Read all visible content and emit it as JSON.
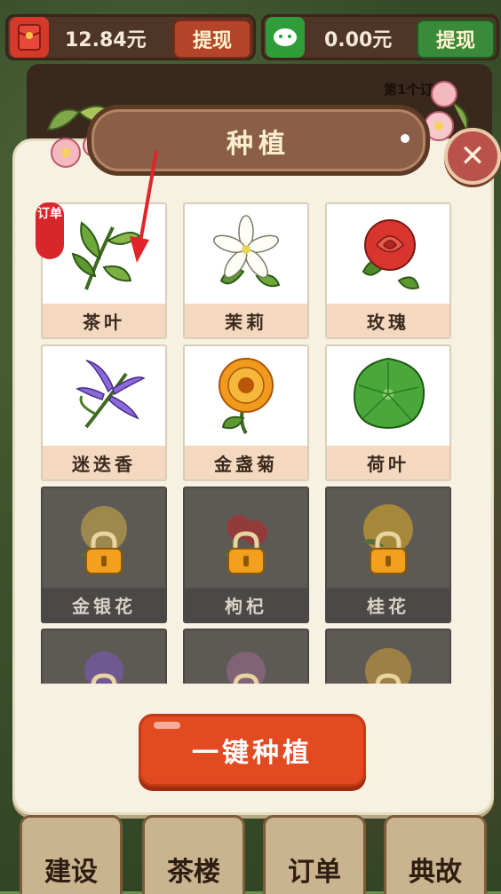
{
  "top_bar": {
    "cash_value": "12.84元",
    "cash_withdraw_label": "提现",
    "wechat_value": "0.00元",
    "wechat_withdraw_label": "提现"
  },
  "background": {
    "order_card_text": "第1个订"
  },
  "panel": {
    "title": "种植",
    "close_label": "✕",
    "order_badge": "订单",
    "plants": [
      {
        "name": "茶叶",
        "locked": false
      },
      {
        "name": "茉莉",
        "locked": false
      },
      {
        "name": "玫瑰",
        "locked": false
      },
      {
        "name": "迷迭香",
        "locked": false
      },
      {
        "name": "金盏菊",
        "locked": false
      },
      {
        "name": "荷叶",
        "locked": false
      },
      {
        "name": "金银花",
        "locked": true
      },
      {
        "name": "枸杞",
        "locked": true
      },
      {
        "name": "桂花",
        "locked": true
      },
      {
        "name": "",
        "locked": true
      },
      {
        "name": "",
        "locked": true
      },
      {
        "name": "",
        "locked": true
      }
    ],
    "one_click_plant_label": "一键种植"
  },
  "bottom_nav": {
    "items": [
      "建设",
      "茶楼",
      "订单",
      "典故"
    ]
  },
  "colors": {
    "accent_red": "#e24a22",
    "panel_bg": "#f7f1e1",
    "title_plate": "#8b5f47",
    "locked_card": "#5d5a56",
    "name_strip": "#f4d8c0"
  },
  "icons": {
    "cash_icon": "red-envelope-icon",
    "wechat_icon": "wechat-icon",
    "close_icon": "close-icon",
    "lock_icon": "padlock-icon",
    "guide_arrow": "arrow-icon"
  }
}
